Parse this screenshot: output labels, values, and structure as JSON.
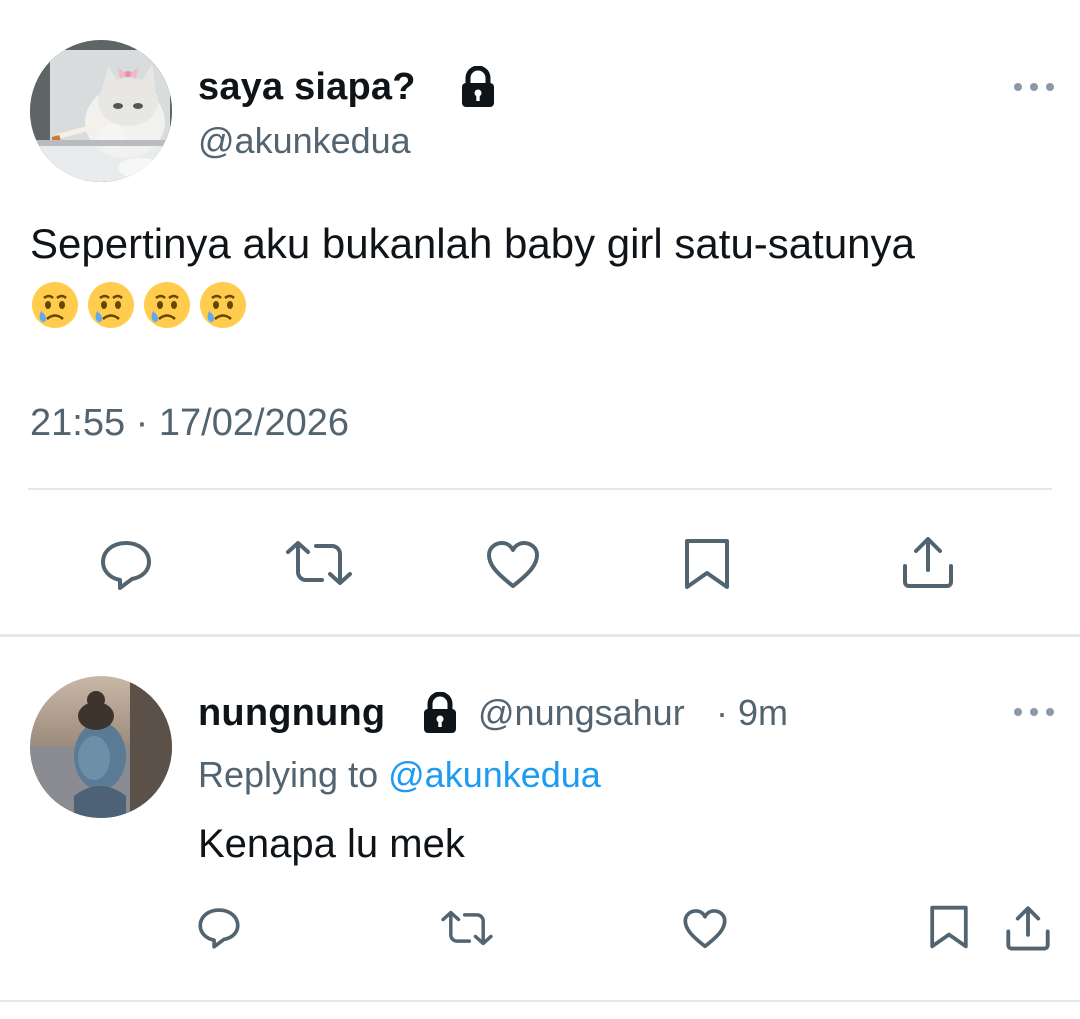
{
  "tweet": {
    "author": {
      "display_name": "saya siapa?",
      "handle": "@akunkedua",
      "avatar": "cat-smoking-avatar",
      "protected_icon": "lock-icon"
    },
    "text": "Sepertinya aku bukanlah baby girl satu-satunya",
    "emojis": [
      "crying-face",
      "crying-face",
      "crying-face",
      "crying-face"
    ],
    "timestamp": "21:55 · 17/02/2026",
    "more_icon": "more-horizontal-icon",
    "actions": [
      {
        "name": "reply",
        "icon": "reply-icon"
      },
      {
        "name": "retweet",
        "icon": "retweet-icon"
      },
      {
        "name": "like",
        "icon": "heart-icon"
      },
      {
        "name": "bookmark",
        "icon": "bookmark-icon"
      },
      {
        "name": "share",
        "icon": "share-icon"
      }
    ]
  },
  "reply": {
    "author": {
      "display_name": "nungnung",
      "handle": "@nungsahur",
      "avatar": "avatar-character-avatar",
      "protected_icon": "lock-icon"
    },
    "time_ago": "· 9m",
    "replying_to_label": "Replying to",
    "replying_to_handle": "@akunkedua",
    "text": "Kenapa lu mek",
    "more_icon": "more-horizontal-icon",
    "actions": [
      {
        "name": "reply",
        "icon": "reply-icon"
      },
      {
        "name": "retweet",
        "icon": "retweet-icon"
      },
      {
        "name": "like",
        "icon": "heart-icon"
      },
      {
        "name": "bookmark",
        "icon": "bookmark-icon"
      },
      {
        "name": "share",
        "icon": "share-icon"
      }
    ]
  },
  "colors": {
    "text": "#0f1419",
    "secondary": "#536471",
    "link": "#1d9bf0",
    "divider": "#e3e8ec"
  }
}
